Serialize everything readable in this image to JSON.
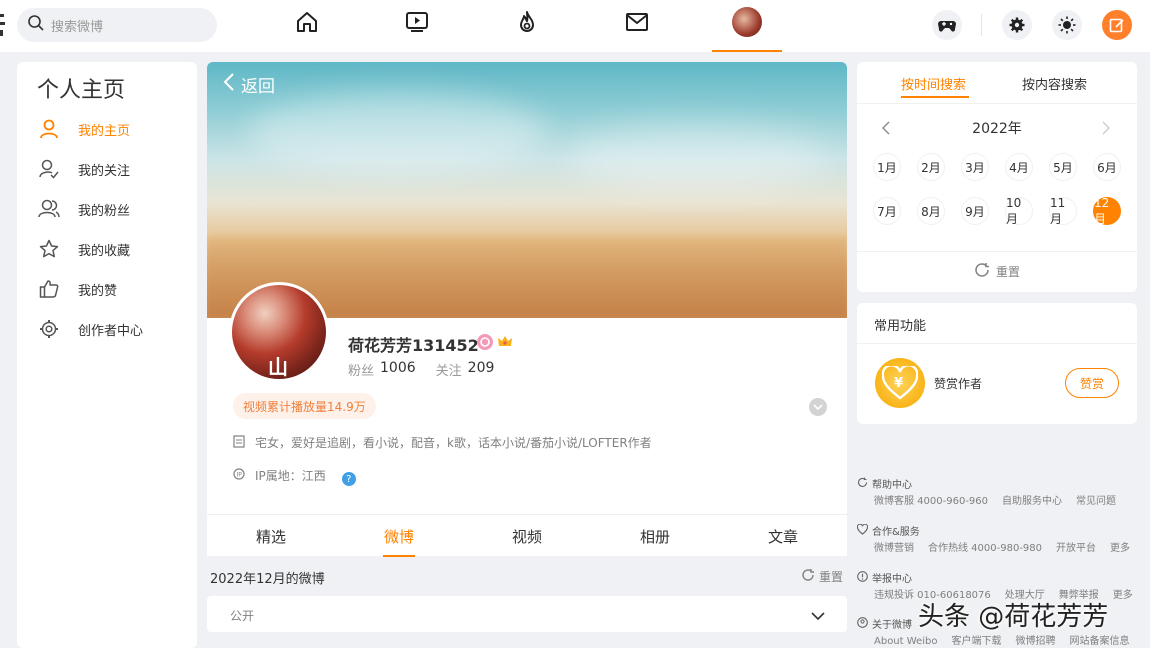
{
  "topbar": {
    "search_placeholder": "搜索微博",
    "nav": [
      "home-icon",
      "video-icon",
      "hot-icon",
      "mail-icon",
      "profile-avatar"
    ],
    "right_buttons": [
      "game-icon",
      "settings-icon",
      "theme-icon",
      "compose-icon"
    ],
    "accent": "#ff8200"
  },
  "sidebar": {
    "title": "个人主页",
    "items": [
      {
        "label": "我的主页",
        "icon": "user-icon",
        "active": true
      },
      {
        "label": "我的关注",
        "icon": "follow-icon",
        "active": false
      },
      {
        "label": "我的粉丝",
        "icon": "fans-icon",
        "active": false
      },
      {
        "label": "我的收藏",
        "icon": "star-icon",
        "active": false
      },
      {
        "label": "我的赞",
        "icon": "thumbs-up-icon",
        "active": false
      },
      {
        "label": "创作者中心",
        "icon": "gear-icon",
        "active": false
      }
    ]
  },
  "profile": {
    "back_label": "返回",
    "name": "荷花芳芳131452",
    "fans_label": "粉丝",
    "fans_count": "1006",
    "follow_label": "关注",
    "follow_count": "209",
    "avatar_mark": "山",
    "video_pill": "视频累计播放量14.9万",
    "bio": "宅女，爱好是追剧，看小说，配音，k歌，话本小说/番茄小说/LOFTER作者",
    "ip": "IP属地：江西",
    "ip_help": "?"
  },
  "tabs": [
    "精选",
    "微博",
    "视频",
    "相册",
    "文章"
  ],
  "active_tab": "微博",
  "feed": {
    "heading": "2022年12月的微博",
    "reset": "重置",
    "visibility": "公开"
  },
  "search_card": {
    "tab_time": "按时间搜索",
    "tab_content": "按内容搜索",
    "year": "2022年",
    "months": [
      "1月",
      "2月",
      "3月",
      "4月",
      "5月",
      "6月",
      "7月",
      "8月",
      "9月",
      "10月",
      "11月",
      "12月"
    ],
    "selected_month": "12月",
    "reset": "重置"
  },
  "functions": {
    "title": "常用功能",
    "tip_label": "赞赏作者",
    "tip_button": "赞赏",
    "tip_symbol": "¥"
  },
  "footer": {
    "help": {
      "title": "帮助中心",
      "links": [
        "微博客服 4000-960-960",
        "自助服务中心",
        "常见问题"
      ]
    },
    "coop": {
      "title": "合作&服务",
      "links": [
        "微博营销",
        "合作热线 4000-980-980",
        "开放平台",
        "更多"
      ]
    },
    "report": {
      "title": "举报中心",
      "links": [
        "违规投诉 010-60618076",
        "处理大厅",
        "舞弊举报",
        "更多"
      ]
    },
    "about": {
      "title": "关于微博",
      "links": [
        "About Weibo",
        "客户端下载",
        "微博招聘",
        "网站备案信息"
      ]
    }
  },
  "watermark": "头条 @荷花芳芳"
}
